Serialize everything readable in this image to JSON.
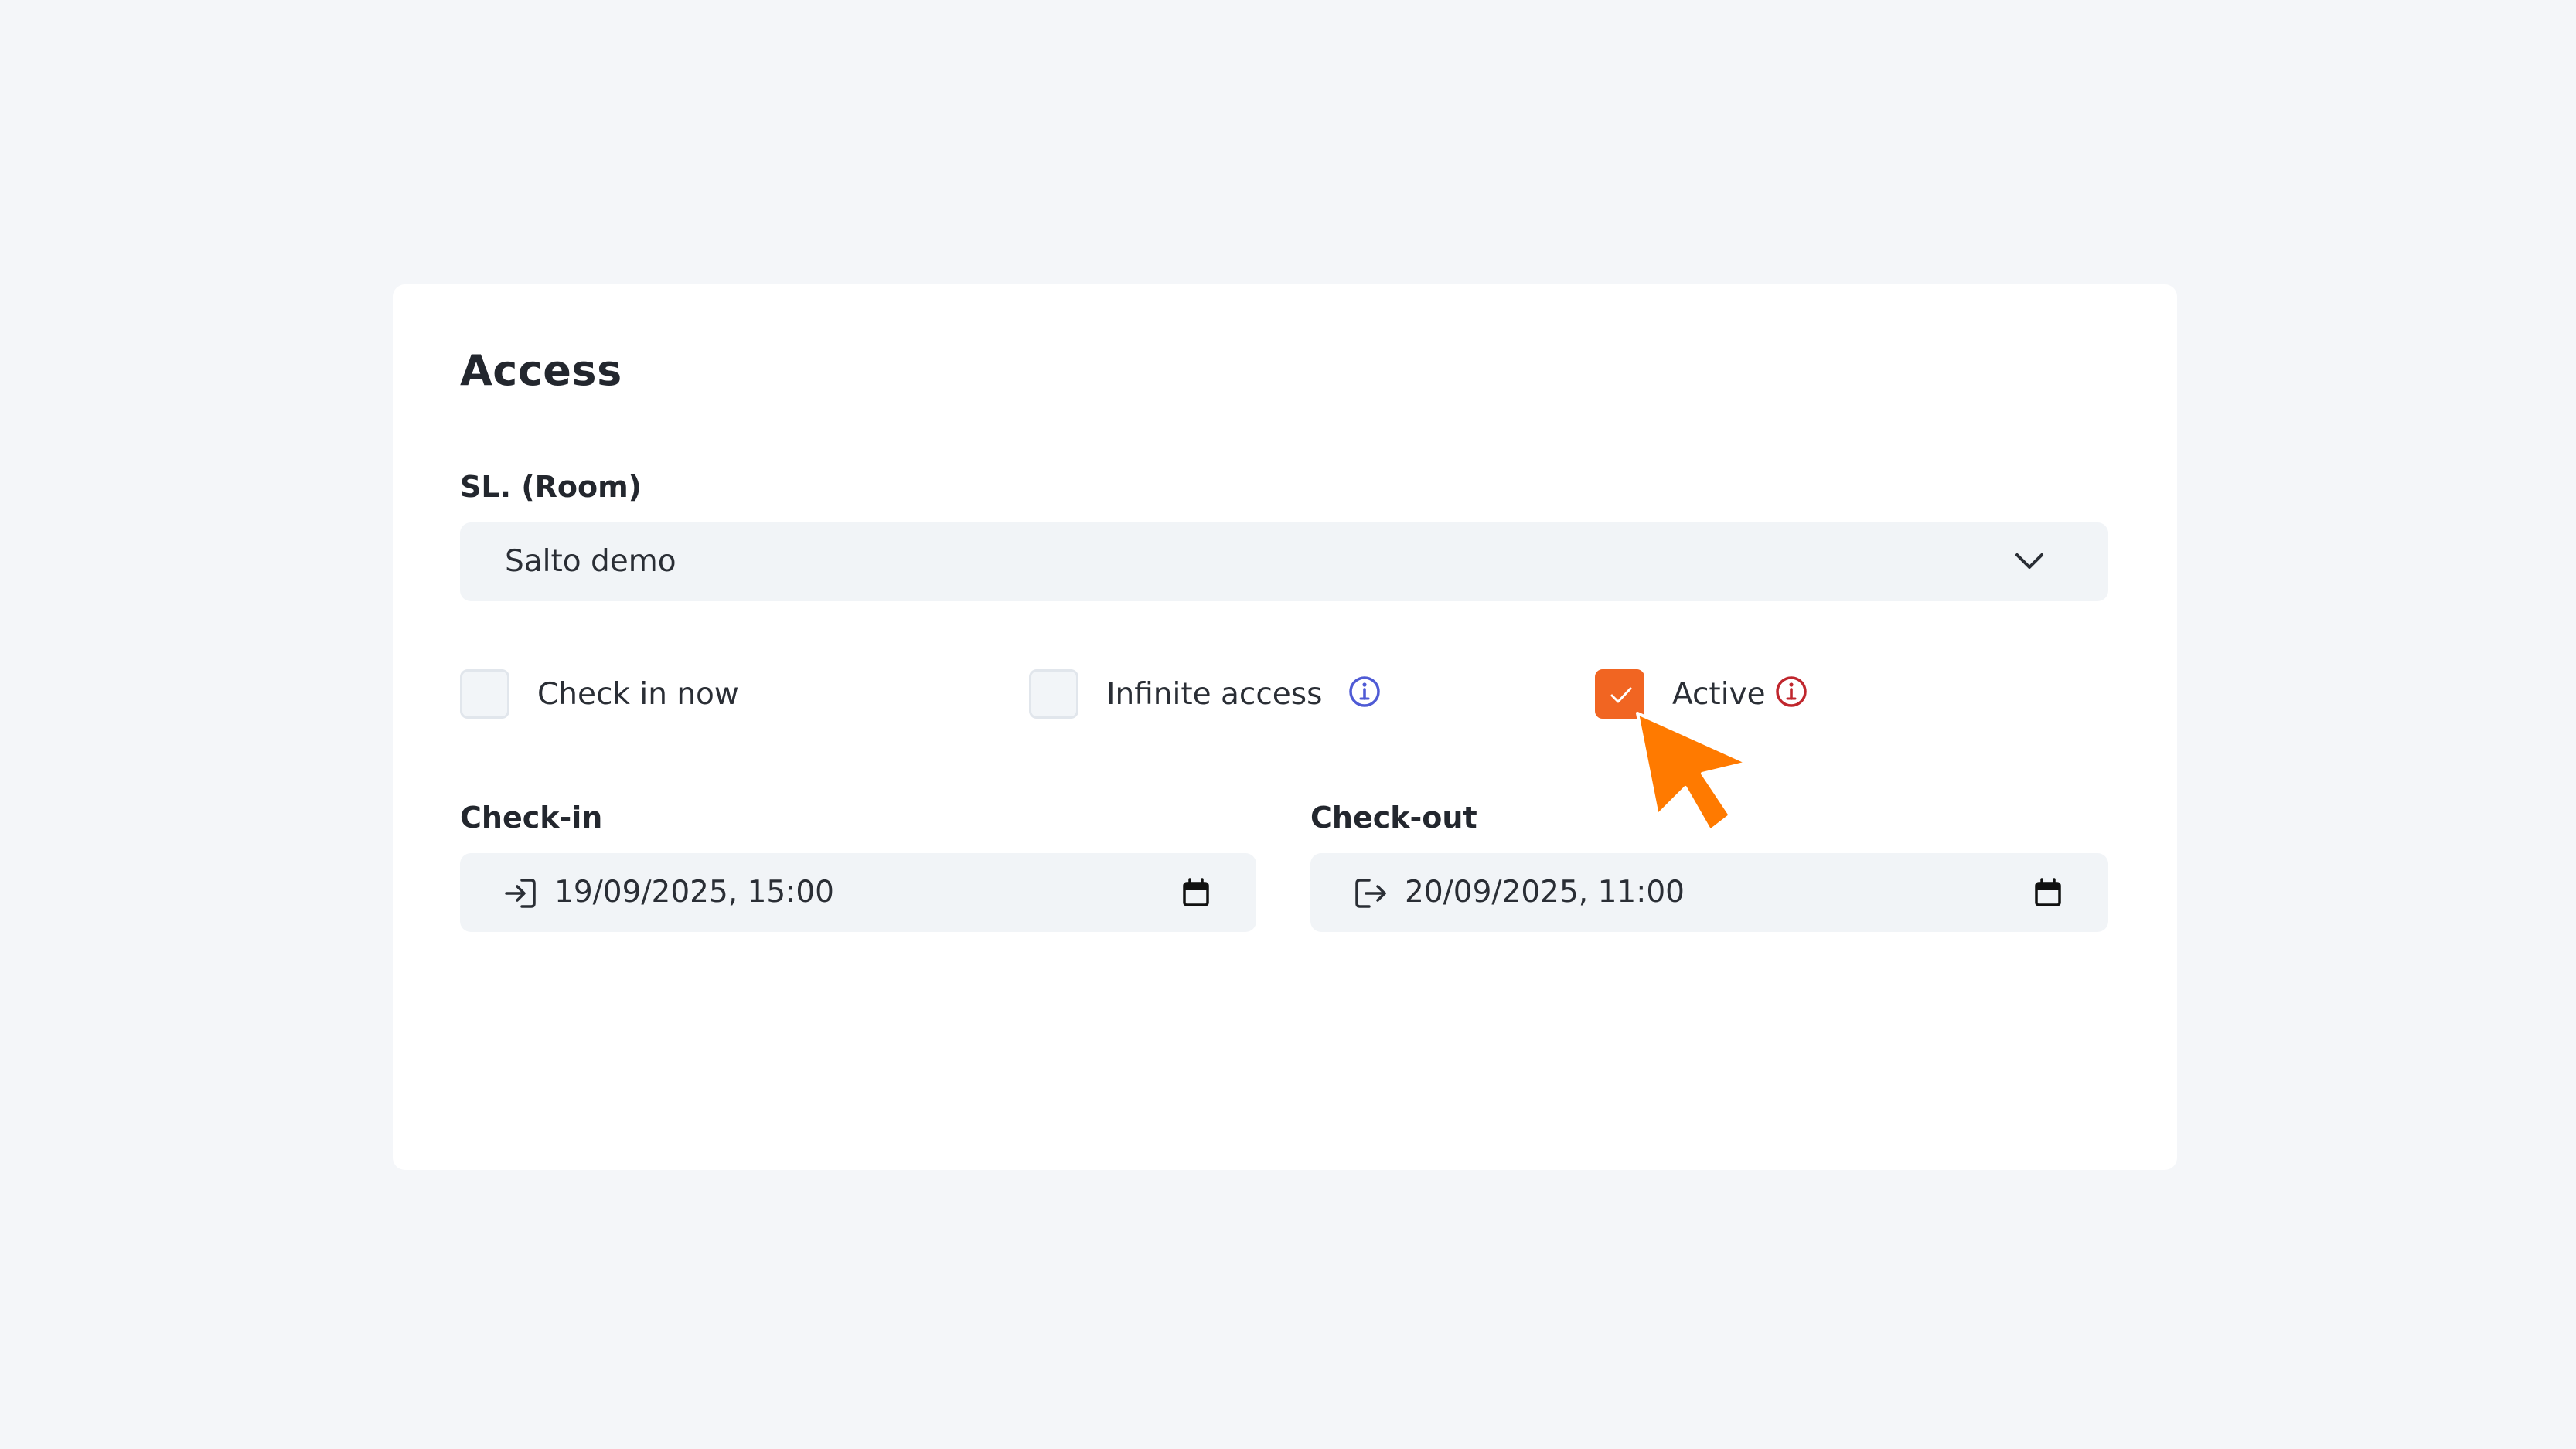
{
  "colors": {
    "accent": "#f16522",
    "cursor": "#ff7a00",
    "info_blue": "#4f5bd5",
    "info_red": "#c0262d"
  },
  "card": {
    "title": "Access"
  },
  "room": {
    "label": "SL. (Room)",
    "value": "Salto demo",
    "icon": "chevron-down-icon"
  },
  "options": {
    "check_in_now": {
      "label": "Check in now",
      "checked": false
    },
    "infinite_access": {
      "label": "Infinite access",
      "checked": false,
      "icon": "info-icon"
    },
    "active": {
      "label": "Active",
      "checked": true,
      "icon": "info-icon"
    }
  },
  "checkin": {
    "label": "Check-in",
    "value": "19/09/2025, 15:00",
    "lead_icon": "sign-in-icon",
    "trail_icon": "calendar-icon"
  },
  "checkout": {
    "label": "Check-out",
    "value": "20/09/2025, 11:00",
    "lead_icon": "sign-out-icon",
    "trail_icon": "calendar-icon"
  }
}
